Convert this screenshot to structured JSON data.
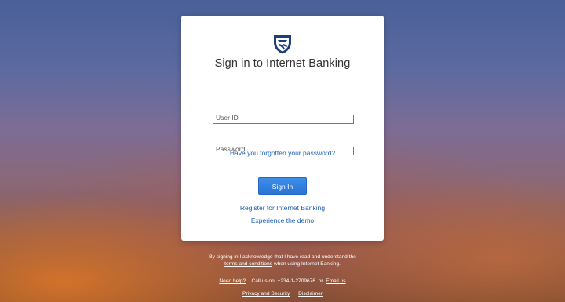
{
  "colors": {
    "brand": "#1b3f7a",
    "link": "#1b5fb0",
    "button": "#2a74d6"
  },
  "logo": {
    "icon": "shield-icon"
  },
  "title": "Sign in to Internet Banking",
  "userid": {
    "placeholder": "User ID",
    "value": ""
  },
  "password": {
    "placeholder": "Password",
    "value": ""
  },
  "forgot_link": "Have you forgotten your password?",
  "sign_in_button": "Sign In",
  "register_link": "Register for Internet Banking",
  "demo_link": "Experience the demo",
  "footer": {
    "ack_line1": "By signing in I acknowledge that I have read and understand the",
    "ack_terms": "terms and conditions",
    "ack_line2_rest": " when using Internet Banking.",
    "need_help": "Need help?",
    "call_us": "Call us on: +234-1-2709676",
    "or": "or",
    "email_us": "Email us",
    "privacy": "Privacy and Security",
    "disclaimer": "Disclaimer"
  }
}
